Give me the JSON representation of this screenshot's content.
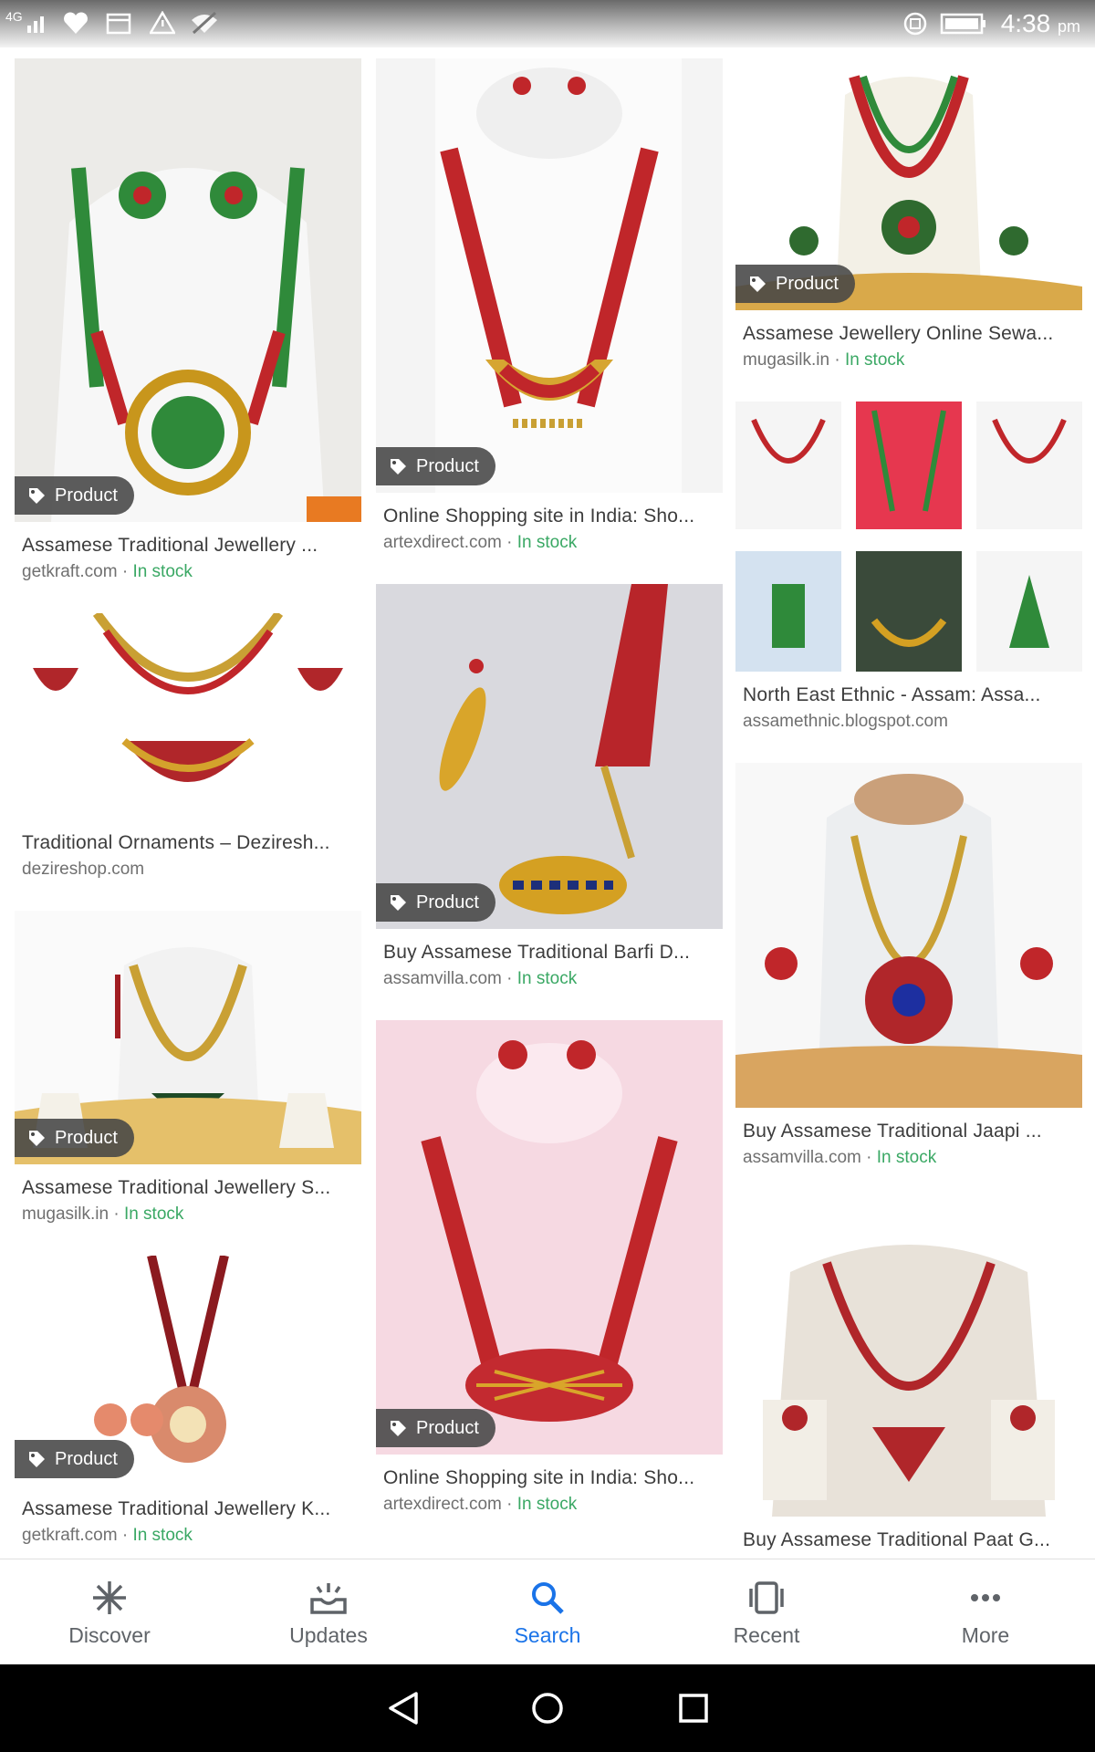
{
  "status_bar": {
    "network": "4G",
    "time": "4:38",
    "ampm": "pm",
    "icons": [
      "signal-icon",
      "heart-icon",
      "calendar-icon",
      "warning-icon",
      "wifi-off-icon",
      "sync-icon",
      "battery-icon"
    ]
  },
  "badge_label": "Product",
  "columns": [
    [
      {
        "title": "Assamese Traditional Jewellery ...",
        "source": "getkraft.com",
        "stock": "In stock",
        "badge": true
      },
      {
        "title": "Traditional Ornaments – Deziresh...",
        "source": "dezireshop.com",
        "stock": "",
        "badge": false
      },
      {
        "title": "Assamese Traditional Jewellery S...",
        "source": "mugasilk.in",
        "stock": "In stock",
        "badge": true
      },
      {
        "title": "Assamese Traditional Jewellery K...",
        "source": "getkraft.com",
        "stock": "In stock",
        "badge": true
      }
    ],
    [
      {
        "title": "Online Shopping site in India: Sho...",
        "source": "artexdirect.com",
        "stock": "In stock",
        "badge": true
      },
      {
        "title": "Buy Assamese Traditional Barfi D...",
        "source": "assamvilla.com",
        "stock": "In stock",
        "badge": true
      },
      {
        "title": "Online Shopping site in India: Sho...",
        "source": "artexdirect.com",
        "stock": "In stock",
        "badge": true
      }
    ],
    [
      {
        "title": "Assamese Jewellery Online Sewa...",
        "source": "mugasilk.in",
        "stock": "In stock",
        "badge": true
      },
      {
        "title": "North East Ethnic - Assam: Assa...",
        "source": "assamethnic.blogspot.com",
        "stock": "",
        "badge": false
      },
      {
        "title": "Buy Assamese Traditional Jaapi ...",
        "source": "assamvilla.com",
        "stock": "In stock",
        "badge": false
      },
      {
        "title": "Buy Assamese Traditional Paat G...",
        "source": "",
        "stock": "",
        "badge": false
      }
    ]
  ],
  "bottom_nav": [
    {
      "label": "Discover",
      "icon": "asterisk-icon",
      "active": false
    },
    {
      "label": "Updates",
      "icon": "updates-icon",
      "active": false
    },
    {
      "label": "Search",
      "icon": "search-icon",
      "active": true
    },
    {
      "label": "Recent",
      "icon": "recent-icon",
      "active": false
    },
    {
      "label": "More",
      "icon": "more-icon",
      "active": false
    }
  ],
  "colors": {
    "accent": "#1a73e8",
    "in_stock": "#3aa864",
    "badge_bg": "#464646"
  }
}
